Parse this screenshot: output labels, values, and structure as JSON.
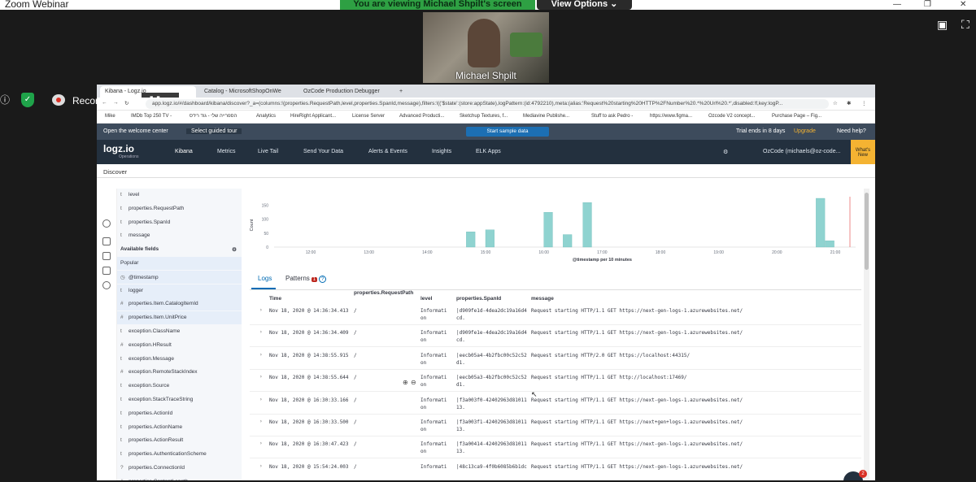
{
  "zoom": {
    "window_title": "Zoom Webinar",
    "viewing_banner": "You are viewing Michael Shpilt's screen",
    "view_options": "View Options ⌄",
    "participant_name": "Michael Shpilt",
    "recording_label": "Recording...",
    "recording_pause": "❚❚  ■"
  },
  "browser": {
    "tabs": [
      {
        "label": "Kibana - Logz.io"
      },
      {
        "label": "Catalog - MicrosoftShopOnWe"
      },
      {
        "label": "OzCode Production Debugger"
      }
    ],
    "new_tab": "+",
    "url": "app.logz.io/#/dashboard/kibana/discover?_a=(columns:!(properties.RequestPath,level,properties.SpanId,message),filters:!(('$state':(store:appState),logPattern:(id:4792210),meta:(alias:'Request%20starting%20HTTP%2FNumber%20.*%20Url%20.*',disabled:!f,key:logP...",
    "bookmarks": [
      "Mike",
      "IMDb Top 250 TV -",
      "הספרייה שלי - גוד רידס",
      "Analytics",
      "HireRight Applicant...",
      "License Server",
      "Advanced Producti...",
      "Sketchup Textures, f...",
      "Mediavine Publishe...",
      "Stuff to ask Pedro -",
      "https://www.figma...",
      "Ozcode V2 concept...",
      "Purchase Page – Fig..."
    ]
  },
  "logz": {
    "welcome": "Open the welcome center",
    "guided_tour": "Select guided tour",
    "sample_data": "Start sample data",
    "trial": "Trial ends in 8 days",
    "upgrade": "Upgrade",
    "need_help": "Need help?",
    "logo": "logz.io",
    "logo_sub": "Operations",
    "nav": [
      "Kibana",
      "Metrics",
      "Live Tail",
      "Send Your Data",
      "Alerts & Events",
      "Insights",
      "ELK Apps"
    ],
    "account": "OzCode (michaels@oz-code...",
    "whats_new": "What's New",
    "page": "Discover"
  },
  "sidebar": {
    "selected": [
      "level",
      "properties.RequestPath",
      "properties.SpanId",
      "message"
    ],
    "available_label": "Available fields",
    "popular_label": "Popular",
    "fields": [
      {
        "type": "◷",
        "name": "@timestamp"
      },
      {
        "type": "t",
        "name": "logger"
      },
      {
        "type": "#",
        "name": "properties.Item.CatalogItemId"
      },
      {
        "type": "#",
        "name": "properties.Item.UnitPrice"
      },
      {
        "type": "t",
        "name": "exception.ClassName"
      },
      {
        "type": "#",
        "name": "exception.HResult"
      },
      {
        "type": "t",
        "name": "exception.Message"
      },
      {
        "type": "#",
        "name": "exception.RemoteStackIndex"
      },
      {
        "type": "t",
        "name": "exception.Source"
      },
      {
        "type": "t",
        "name": "exception.StackTraceString"
      },
      {
        "type": "t",
        "name": "properties.ActionId"
      },
      {
        "type": "t",
        "name": "properties.ActionName"
      },
      {
        "type": "t",
        "name": "properties.ActionResult"
      },
      {
        "type": "t",
        "name": "properties.AuthenticationScheme"
      },
      {
        "type": "?",
        "name": "properties.ConnectionId"
      },
      {
        "type": "#",
        "name": "properties.ContentLength"
      }
    ]
  },
  "chart_data": {
    "type": "bar",
    "title": "",
    "xlabel": "@timestamp per 10 minutes",
    "ylabel": "Count",
    "yticks": [
      0,
      50,
      100,
      150
    ],
    "ylim": [
      0,
      175
    ],
    "xticks": [
      "12:00",
      "13:00",
      "14:00",
      "15:00",
      "16:00",
      "17:00",
      "18:00",
      "19:00",
      "20:00",
      "21:00"
    ],
    "x_hours": [
      14.67,
      15.0,
      16.0,
      16.33,
      16.67,
      20.67,
      20.83
    ],
    "values": [
      55,
      62,
      125,
      45,
      160,
      175,
      23
    ],
    "color": "#8fd3d0"
  },
  "tabs": {
    "logs": "Logs",
    "patterns": "Patterns",
    "patterns_badge": "1",
    "help": "?"
  },
  "table": {
    "headers": [
      "Time",
      "properties.RequestPath",
      "level",
      "properties.SpanId",
      "message"
    ],
    "rows": [
      {
        "time": "Nov 18, 2020 @ 14:36:34.413",
        "path": "/",
        "level": "Informati\non",
        "span": "|d909fe1d-4dea2dc19a16d4\ncd.",
        "message": "Request starting HTTP/1.1 GET https://next-gen-logs-1.azurewebsites.net/"
      },
      {
        "time": "Nov 18, 2020 @ 14:36:34.409",
        "path": "/",
        "level": "Informati\non",
        "span": "|d909fe1e-4dea2dc19a16d4\ncd.",
        "message": "Request starting HTTP/1.1 GET https://next-gen-logs-1.azurewebsites.net/"
      },
      {
        "time": "Nov 18, 2020 @ 14:38:55.915",
        "path": "/",
        "level": "Informati\non",
        "span": "|eecb05a4-4b2fbc00c52c52\nd1.",
        "message": "Request starting HTTP/2.0 GET https://localhost:44315/"
      },
      {
        "time": "Nov 18, 2020 @ 14:38:55.644",
        "path": "/",
        "level": "Informati\non",
        "span": "|eecb05a3-4b2fbc00c52c52\nd1.",
        "message": "Request starting HTTP/1.1 GET http://localhost:17469/"
      },
      {
        "time": "Nov 18, 2020 @ 16:30:33.166",
        "path": "/",
        "level": "Informati\non",
        "span": "|f3a003f0-42402963d81011\n13.",
        "message": "Request starting HTTP/1.1 GET https://next-gen-logs-1.azurewebsites.net/"
      },
      {
        "time": "Nov 18, 2020 @ 16:30:33.500",
        "path": "/",
        "level": "Informati\non",
        "span": "|f3a003f1-42402963d81011\n13.",
        "message": "Request starting HTTP/1.1 GET https://next+gen+logs-1.azurewebsites.net/"
      },
      {
        "time": "Nov 18, 2020 @ 16:30:47.423",
        "path": "/",
        "level": "Informati\non",
        "span": "|f3a00414-42402963d81011\n13.",
        "message": "Request starting HTTP/1.1 GET https://next-gen-logs-1.azurewebsites.net/"
      },
      {
        "time": "Nov 18, 2020 @ 15:54:24.003",
        "path": "/",
        "level": "Informati",
        "span": "|48c13ca9-4f0b6085b6b1dc",
        "message": "Request starting HTTP/1.1 GET https://next-gen-logs-1.azurewebsites.net/"
      }
    ]
  },
  "chat_badge": "2"
}
